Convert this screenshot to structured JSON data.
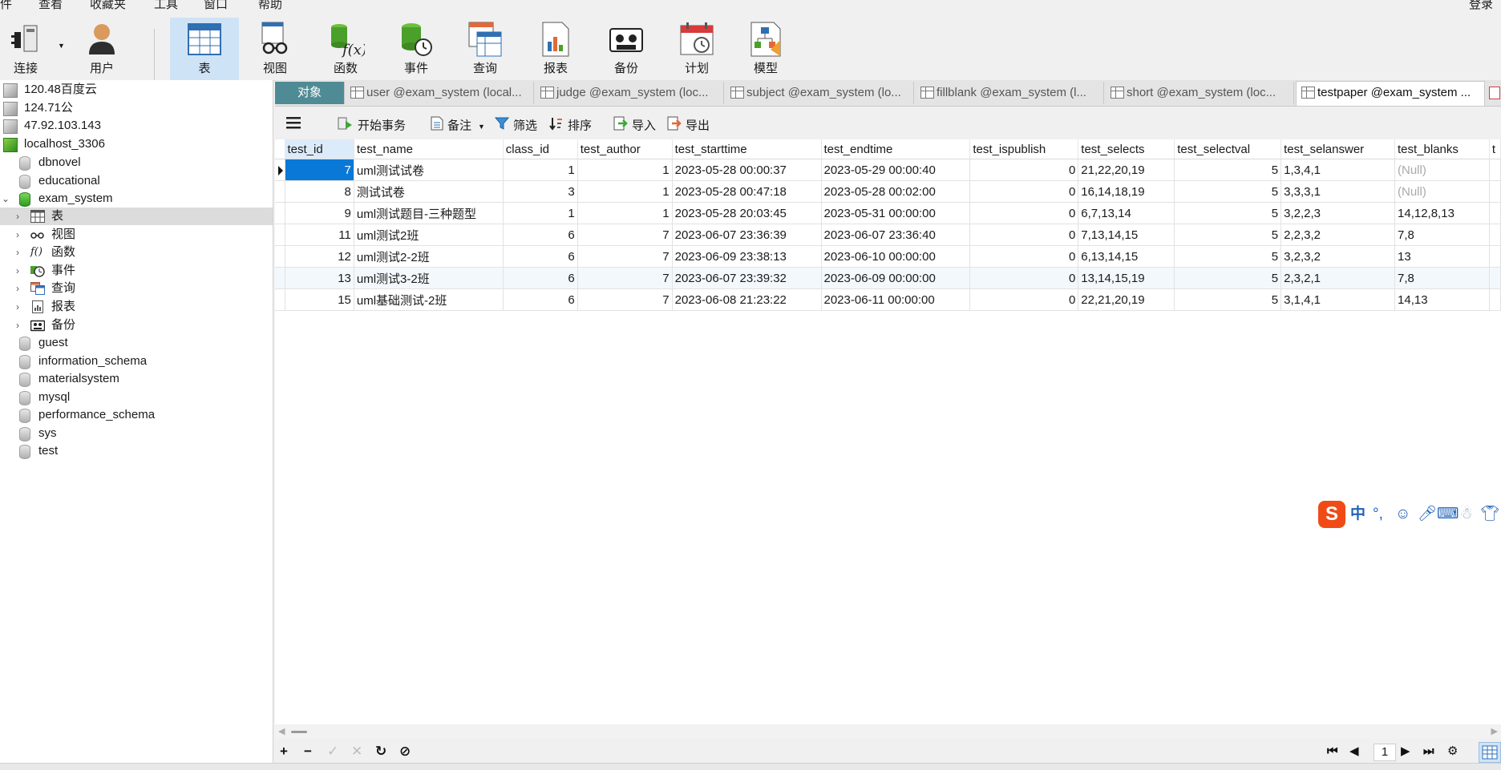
{
  "menu": {
    "items": [
      "件",
      "查看",
      "收藏夹",
      "工具",
      "窗口",
      "帮助"
    ],
    "login": "登录"
  },
  "toolbar": {
    "buttons": [
      {
        "label": "连接",
        "icon": "plug-icon"
      },
      {
        "label": "用户",
        "icon": "user-icon"
      },
      {
        "label": "表",
        "icon": "table-icon",
        "active": true
      },
      {
        "label": "视图",
        "icon": "view-icon"
      },
      {
        "label": "函数",
        "icon": "function-icon"
      },
      {
        "label": "事件",
        "icon": "event-icon"
      },
      {
        "label": "查询",
        "icon": "query-icon"
      },
      {
        "label": "报表",
        "icon": "report-icon"
      },
      {
        "label": "备份",
        "icon": "backup-icon"
      },
      {
        "label": "计划",
        "icon": "schedule-icon"
      },
      {
        "label": "模型",
        "icon": "model-icon"
      }
    ]
  },
  "sidebar": {
    "connections": [
      "120.48百度云",
      "124.71公",
      "47.92.103.143",
      "localhost_3306"
    ],
    "databases_before": [
      "dbnovel",
      "educational"
    ],
    "open_db": "exam_system",
    "children": [
      "表",
      "视图",
      "函数",
      "事件",
      "查询",
      "报表",
      "备份"
    ],
    "databases_after": [
      "guest",
      "information_schema",
      "materialsystem",
      "mysql",
      "performance_schema",
      "sys",
      "test"
    ]
  },
  "tabs": {
    "objects": "对象",
    "items": [
      "user @exam_system (local...",
      "judge @exam_system (loc...",
      "subject @exam_system (lo...",
      "fillblank @exam_system (l...",
      "short @exam_system (loc...",
      "testpaper @exam_system ..."
    ],
    "active_index": 5
  },
  "data_toolbar": {
    "begin_tx": "开始事务",
    "note": "备注",
    "filter": "筛选",
    "sort": "排序",
    "import": "导入",
    "export": "导出"
  },
  "grid": {
    "columns": [
      "test_id",
      "test_name",
      "class_id",
      "test_author",
      "test_starttime",
      "test_endtime",
      "test_ispublish",
      "test_selects",
      "test_selectval",
      "test_selanswer",
      "test_blanks",
      "t"
    ],
    "rows": [
      [
        "7",
        "uml测试试卷",
        "1",
        "1",
        "2023-05-28 00:00:37",
        "2023-05-29 00:00:40",
        "0",
        "21,22,20,19",
        "5",
        "1,3,4,1",
        "(Null)",
        ""
      ],
      [
        "8",
        "测试试卷",
        "3",
        "1",
        "2023-05-28 00:47:18",
        "2023-05-28 00:02:00",
        "0",
        "16,14,18,19",
        "5",
        "3,3,3,1",
        "(Null)",
        ""
      ],
      [
        "9",
        "uml测试题目-三种题型",
        "1",
        "1",
        "2023-05-28 20:03:45",
        "2023-05-31 00:00:00",
        "0",
        "6,7,13,14",
        "5",
        "3,2,2,3",
        "14,12,8,13",
        ""
      ],
      [
        "11",
        "uml测试2班",
        "6",
        "7",
        "2023-06-07 23:36:39",
        "2023-06-07 23:36:40",
        "0",
        "7,13,14,15",
        "5",
        "2,2,3,2",
        "7,8",
        ""
      ],
      [
        "12",
        "uml测试2-2班",
        "6",
        "7",
        "2023-06-09 23:38:13",
        "2023-06-10 00:00:00",
        "0",
        "6,13,14,15",
        "5",
        "3,2,3,2",
        "13",
        ""
      ],
      [
        "13",
        "uml测试3-2班",
        "6",
        "7",
        "2023-06-07 23:39:32",
        "2023-06-09 00:00:00",
        "0",
        "13,14,15,19",
        "5",
        "2,3,2,1",
        "7,8",
        ""
      ],
      [
        "15",
        "uml基础测试-2班",
        "6",
        "7",
        "2023-06-08 21:23:22",
        "2023-06-11 00:00:00",
        "0",
        "22,21,20,19",
        "5",
        "3,1,4,1",
        "14,13",
        ""
      ]
    ]
  },
  "bottom": {
    "add": "+",
    "remove": "−",
    "apply": "✓",
    "cancel": "✕",
    "refresh": "↻",
    "stop": "⊘",
    "page": "1"
  },
  "ime": {
    "label": "中"
  }
}
